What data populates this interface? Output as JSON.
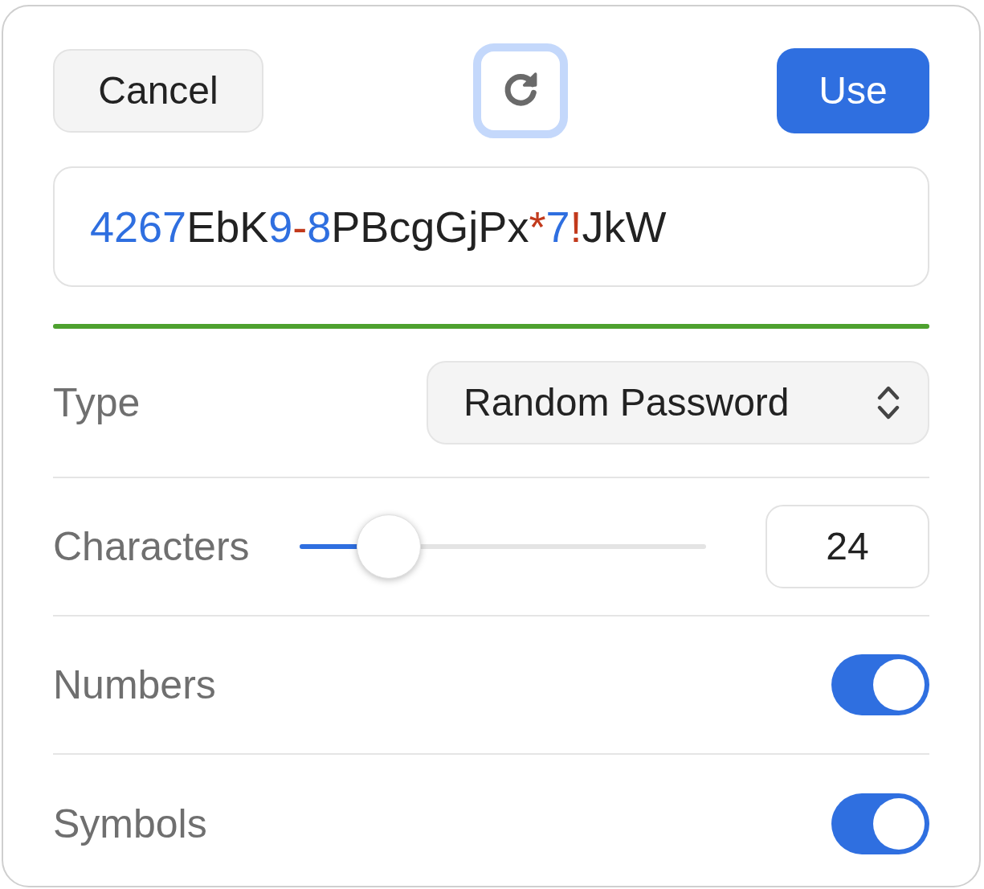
{
  "buttons": {
    "cancel": "Cancel",
    "regenerate": {
      "focused": true
    },
    "use": "Use"
  },
  "password": [
    {
      "text": "4267",
      "kind": "digit"
    },
    {
      "text": "EbK",
      "kind": "letter"
    },
    {
      "text": "9",
      "kind": "digit"
    },
    {
      "text": "-",
      "kind": "symbol"
    },
    {
      "text": "8",
      "kind": "digit"
    },
    {
      "text": "PBcgGjPx",
      "kind": "letter"
    },
    {
      "text": "*",
      "kind": "symbol"
    },
    {
      "text": "7",
      "kind": "digit"
    },
    {
      "text": "!",
      "kind": "symbol"
    },
    {
      "text": "JkW",
      "kind": "letter"
    }
  ],
  "strength": {
    "level": 1,
    "color": "#4ea12f"
  },
  "options": [
    {
      "kind": "select",
      "label": "Type",
      "value": "Random Password"
    },
    {
      "kind": "slider",
      "label": "Characters",
      "level": 0.22,
      "value": "24"
    },
    {
      "kind": "toggle",
      "label": "Numbers",
      "on": true
    },
    {
      "kind": "toggle",
      "label": "Symbols",
      "on": true
    }
  ]
}
